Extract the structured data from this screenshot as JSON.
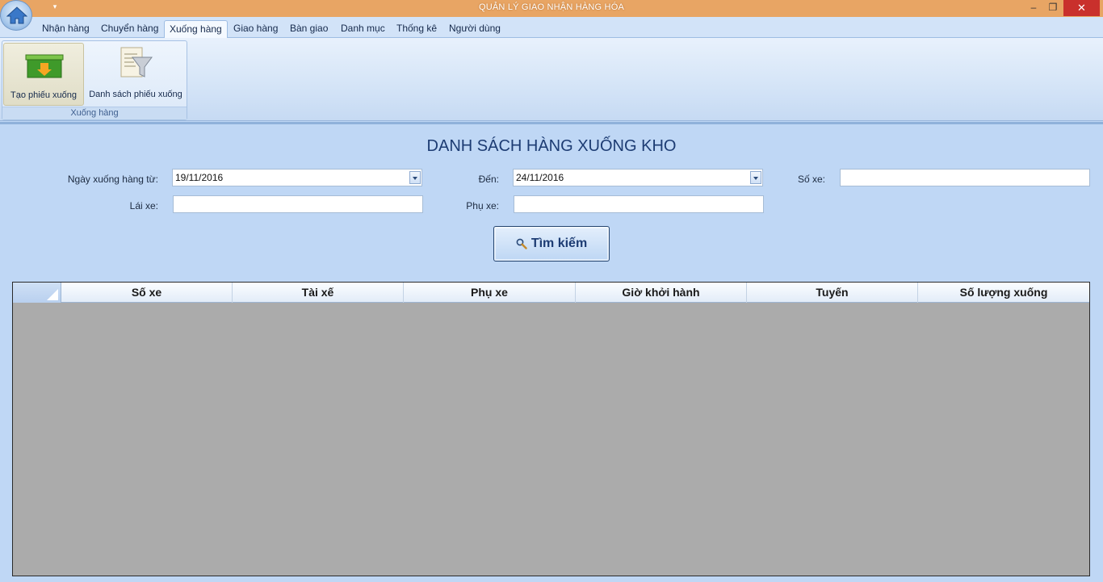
{
  "window": {
    "title": "QUẢN LÝ GIAO NHẬN HÀNG HÓA",
    "minimize": "–",
    "maximize": "❐",
    "close": "✕",
    "qat": "▾"
  },
  "tabs": [
    {
      "label": "Nhận hàng"
    },
    {
      "label": "Chuyển hàng"
    },
    {
      "label": "Xuống hàng",
      "active": true
    },
    {
      "label": "Giao hàng"
    },
    {
      "label": "Bàn giao"
    },
    {
      "label": "Danh mục"
    },
    {
      "label": "Thống kê"
    },
    {
      "label": "Người dùng"
    }
  ],
  "ribbon": {
    "group_label": "Xuống hàng",
    "create_label": "Tạo phiếu xuống",
    "list_label": "Danh sách phiếu xuống"
  },
  "form": {
    "title": "DANH SÁCH HÀNG XUỐNG KHO",
    "from_label": "Ngày xuống hàng từ:",
    "from_value": "19/11/2016",
    "to_label": "Đến:",
    "to_value": "24/11/2016",
    "plate_label": "Số xe:",
    "plate_value": "",
    "driver_label": "Lái xe:",
    "driver_value": "",
    "assistant_label": "Phụ xe:",
    "assistant_value": "",
    "search_label": "Tìm kiếm"
  },
  "grid": {
    "columns": [
      "Số xe",
      "Tài xế",
      "Phụ xe",
      "Giờ khởi hành",
      "Tuyến",
      "Số lượng xuống"
    ],
    "rows": []
  },
  "colors": {
    "titlebar": "#e8a564",
    "accent": "#1d3c73",
    "grid_empty": "#ababab",
    "close": "#c9302c"
  },
  "icons": {
    "app": "home-icon",
    "create": "green-box-down-icon",
    "list": "funnel-document-icon",
    "search": "magnifier-icon"
  }
}
